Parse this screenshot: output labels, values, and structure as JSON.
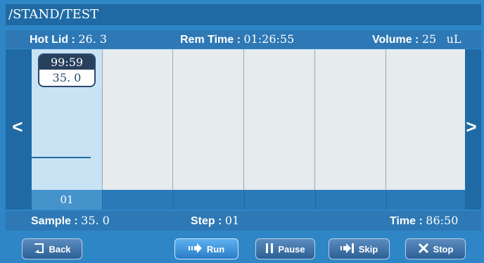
{
  "title": "/STAND/TEST",
  "header": {
    "hot_lid_label": "Hot Lid :",
    "hot_lid_value": "26. 3",
    "rem_time_label": "Rem Time :",
    "rem_time_value": "01:26:55",
    "volume_label": "Volume :",
    "volume_value": "25",
    "volume_unit": "uL"
  },
  "program": {
    "active_step": {
      "time": "99:59",
      "temp": "35. 0",
      "label": "01"
    },
    "nav_left": "<",
    "nav_right": ">"
  },
  "status": {
    "sample_label": "Sample :",
    "sample_value": "35. 0",
    "step_label": "Step :",
    "step_value": "01",
    "time_label": "Time :",
    "time_value": "86:50"
  },
  "buttons": {
    "back": "Back",
    "run": "Run",
    "pause": "Pause",
    "skip": "Skip",
    "stop": "Stop"
  },
  "icons": {
    "back": "back-arrow-icon",
    "run": "play-arrow-icon",
    "pause": "pause-icon",
    "skip": "skip-icon",
    "stop": "x-icon"
  },
  "colors": {
    "background": "#2f86c6",
    "title_bar": "#1f6aa4",
    "active_column": "#c9e3f5",
    "run_button": "#2a7cc8"
  }
}
